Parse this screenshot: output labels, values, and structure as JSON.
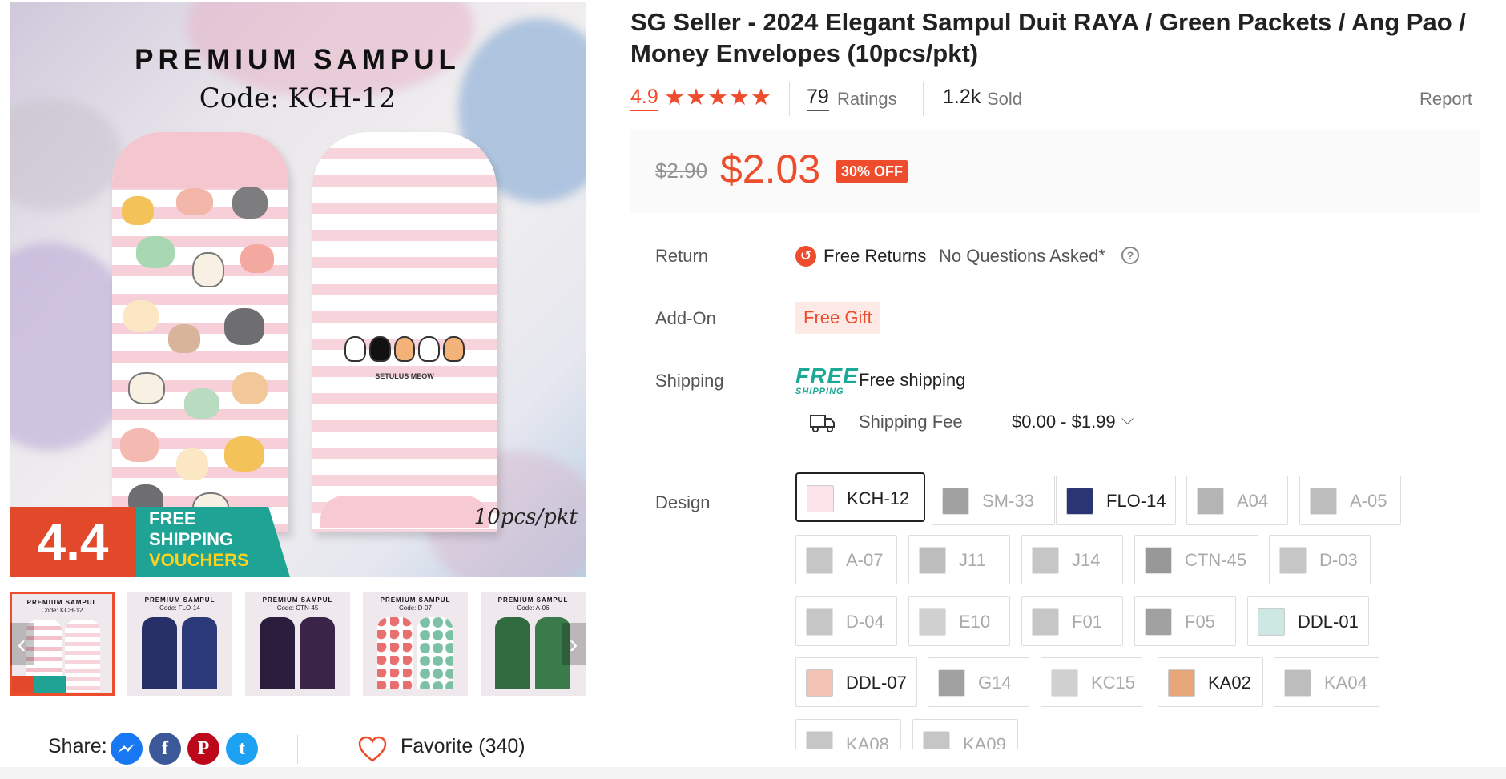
{
  "gallery": {
    "main_image": {
      "heading": "PREMIUM SAMPUL",
      "code": "Code: KCH-12",
      "pack": "10pcs/pkt",
      "envelope_label": "SETULUS MEOW",
      "promo_number": "4.4",
      "promo_lines": [
        "FREE",
        "SHIPPING",
        "VOUCHERS"
      ]
    },
    "thumbnails": [
      {
        "title": "PREMIUM SAMPUL",
        "code": "Code: KCH-12"
      },
      {
        "title": "PREMIUM SAMPUL",
        "code": "Code: FLO-14"
      },
      {
        "title": "PREMIUM SAMPUL",
        "code": "Code: CTN-45"
      },
      {
        "title": "PREMIUM SAMPUL",
        "code": "Code: D-07"
      },
      {
        "title": "PREMIUM SAMPUL",
        "code": "Code: A-06"
      }
    ],
    "prev_arrow": "‹",
    "next_arrow": "›"
  },
  "share": {
    "label": "Share:",
    "networks": [
      {
        "name": "messenger-icon",
        "glyph": "⚡",
        "color": "#1877f2"
      },
      {
        "name": "facebook-icon",
        "glyph": "f",
        "color": "#3b5998"
      },
      {
        "name": "pinterest-icon",
        "glyph": "P",
        "color": "#bd081c"
      },
      {
        "name": "twitter-icon",
        "glyph": "t",
        "color": "#1da1f2"
      }
    ]
  },
  "favorite": {
    "label": "Favorite (340)"
  },
  "product": {
    "title": "SG Seller - 2024 Elegant Sampul Duit RAYA / Green Packets / Ang Pao / Money Envelopes (10pcs/pkt)",
    "rating": "4.9",
    "stars": "★★★★★",
    "ratings_count": "79",
    "ratings_label": "Ratings",
    "sold_count": "1.2k",
    "sold_label": "Sold",
    "report": "Report"
  },
  "price": {
    "original": "$2.90",
    "current": "$2.03",
    "discount": "30% OFF"
  },
  "return": {
    "label": "Return",
    "icon": "↺",
    "main": "Free Returns",
    "sub": "No Questions Asked*",
    "help": "?"
  },
  "addon": {
    "label": "Add-On",
    "badge": "Free Gift"
  },
  "shipping": {
    "label": "Shipping",
    "logo_top": "FREE",
    "logo_bottom": "SHIPPING",
    "main": "Free shipping",
    "fee_label": "Shipping Fee",
    "fee_value": "$0.00 - $1.99",
    "chevron": "⌵"
  },
  "design": {
    "label": "Design",
    "options": [
      {
        "label": "KCH-12",
        "state": "selected"
      },
      {
        "label": "SM-33",
        "state": "disabled"
      },
      {
        "label": "FLO-14",
        "state": "available"
      },
      {
        "label": "A04",
        "state": "disabled"
      },
      {
        "label": "A-05",
        "state": "disabled"
      },
      {
        "label": "A-07",
        "state": "disabled"
      },
      {
        "label": "J11",
        "state": "disabled"
      },
      {
        "label": "J14",
        "state": "disabled"
      },
      {
        "label": "CTN-45",
        "state": "disabled"
      },
      {
        "label": "D-03",
        "state": "disabled"
      },
      {
        "label": "D-04",
        "state": "disabled"
      },
      {
        "label": "E10",
        "state": "disabled"
      },
      {
        "label": "F01",
        "state": "disabled"
      },
      {
        "label": "F05",
        "state": "disabled"
      },
      {
        "label": "DDL-01",
        "state": "available"
      },
      {
        "label": "DDL-07",
        "state": "available"
      },
      {
        "label": "G14",
        "state": "disabled"
      },
      {
        "label": "KC15",
        "state": "disabled"
      },
      {
        "label": "KA02",
        "state": "available"
      },
      {
        "label": "KA04",
        "state": "disabled"
      },
      {
        "label": "KA08",
        "state": "disabled"
      },
      {
        "label": "KA09",
        "state": "disabled"
      }
    ]
  },
  "colors": {
    "accent": "#ee4d2d",
    "free_shipping": "#1ba895",
    "promo_green": "#1fa394"
  }
}
